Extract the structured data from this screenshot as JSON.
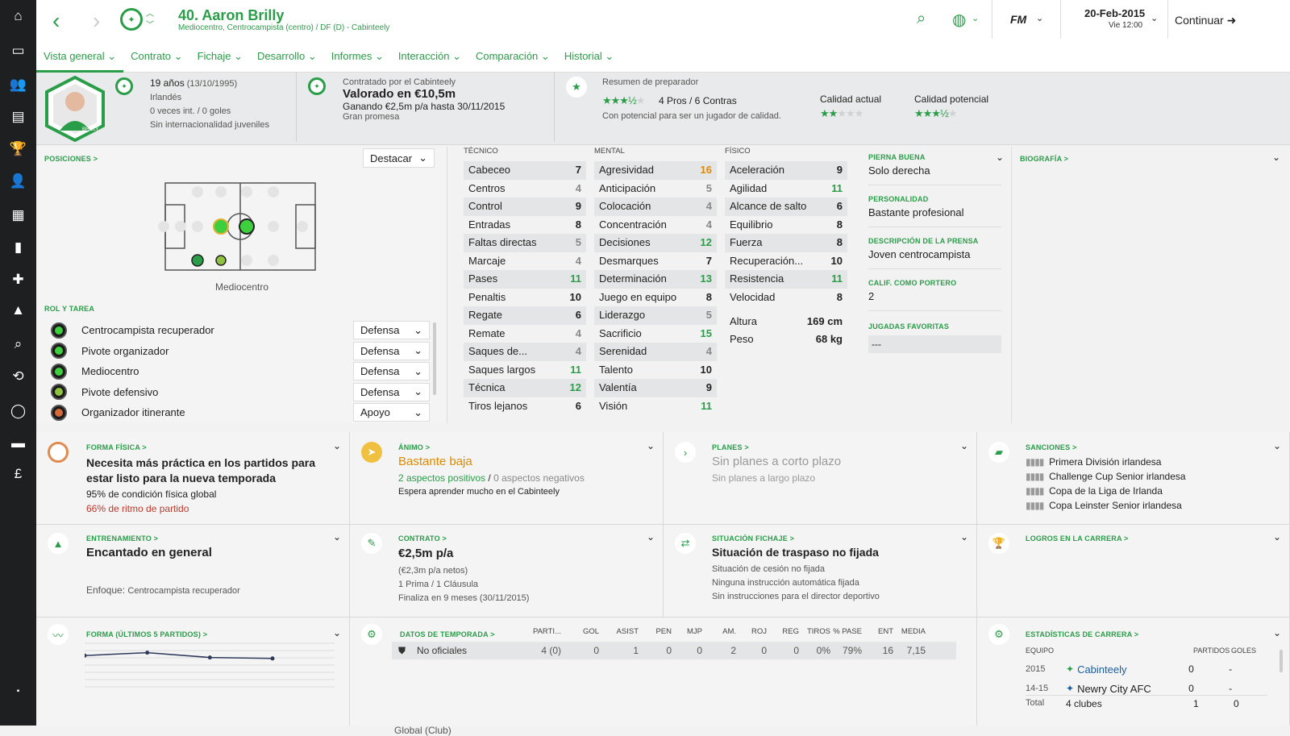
{
  "sidebar": {
    "icons": [
      "home-icon",
      "inbox-icon",
      "squad-icon",
      "calendar-icon",
      "trophy-icon",
      "youth-icon",
      "tactics-icon",
      "scouting-icon",
      "staff-icon",
      "training-icon",
      "search-icon",
      "transfers-icon",
      "club-icon",
      "finances-icon",
      "money-icon",
      "flag-icon"
    ]
  },
  "player": {
    "title": "40. Aaron Brilly",
    "subtitle": "Mediocentro, Centrocampista (centro) / DF (D) - Cabinteely",
    "age": "19 años",
    "dob": "(13/10/1995)",
    "nationality": "Irlandés",
    "caps": "0 veces int. / 0 goles",
    "youth_caps": "Sin internacionalidad juveniles",
    "shirt_name": "BRILLY"
  },
  "tabs": [
    "Vista general",
    "Contrato",
    "Fichaje",
    "Desarrollo",
    "Informes",
    "Interacción",
    "Comparación",
    "Historial"
  ],
  "topbar": {
    "date": "20-Feb-2015",
    "time": "Vie 12:00",
    "continue_label": "Continuar",
    "fm_label": "FM"
  },
  "contract_summary": {
    "line1": "Contratado por el Cabinteely",
    "value": "Valorado en €10,5m",
    "wage": "Ganando €2,5m p/a hasta 30/11/2015",
    "tag": "Gran promesa"
  },
  "coach_report": {
    "label": "Resumen de preparador",
    "pros_cons": "4 Pros / 6 Contras",
    "note": "Con potencial para ser un jugador de calidad.",
    "current_label": "Calidad actual",
    "potential_label": "Calidad potencial",
    "summary_stars": 3.5,
    "current_stars": 2,
    "potential_stars": 3.5
  },
  "positions": {
    "label": "POSICIONES >",
    "highlight_label": "Destacar",
    "position_name": "Mediocentro"
  },
  "roles": {
    "label": "ROL Y TAREA",
    "items": [
      {
        "name": "Centrocampista recuperador",
        "duty": "Defensa",
        "color": "#3ecf3e"
      },
      {
        "name": "Pivote organizador",
        "duty": "Defensa",
        "color": "#3ecf3e"
      },
      {
        "name": "Mediocentro",
        "duty": "Defensa",
        "color": "#3ecf3e"
      },
      {
        "name": "Pivote defensivo",
        "duty": "Defensa",
        "color": "#8fc23e"
      },
      {
        "name": "Organizador itinerante",
        "duty": "Apoyo",
        "color": "#d26a3a"
      }
    ]
  },
  "attributes": {
    "technical_label": "TÉCNICO",
    "mental_label": "MENTAL",
    "physical_label": "FÍSICO",
    "technical": [
      {
        "name": "Cabeceo",
        "value": "7",
        "c": "b"
      },
      {
        "name": "Centros",
        "value": "4",
        "c": "g"
      },
      {
        "name": "Control",
        "value": "9",
        "c": "b"
      },
      {
        "name": "Entradas",
        "value": "8",
        "c": "b"
      },
      {
        "name": "Faltas directas",
        "value": "5",
        "c": "g"
      },
      {
        "name": "Marcaje",
        "value": "4",
        "c": "g"
      },
      {
        "name": "Pases",
        "value": "11",
        "c": "gr"
      },
      {
        "name": "Penaltis",
        "value": "10",
        "c": "b"
      },
      {
        "name": "Regate",
        "value": "6",
        "c": "b"
      },
      {
        "name": "Remate",
        "value": "4",
        "c": "g"
      },
      {
        "name": "Saques de...",
        "value": "4",
        "c": "g"
      },
      {
        "name": "Saques largos",
        "value": "11",
        "c": "gr"
      },
      {
        "name": "Técnica",
        "value": "12",
        "c": "gr"
      },
      {
        "name": "Tiros lejanos",
        "value": "6",
        "c": "b"
      }
    ],
    "mental": [
      {
        "name": "Agresividad",
        "value": "16",
        "c": "o"
      },
      {
        "name": "Anticipación",
        "value": "5",
        "c": "g"
      },
      {
        "name": "Colocación",
        "value": "4",
        "c": "g"
      },
      {
        "name": "Concentración",
        "value": "4",
        "c": "g"
      },
      {
        "name": "Decisiones",
        "value": "12",
        "c": "gr"
      },
      {
        "name": "Desmarques",
        "value": "7",
        "c": "b"
      },
      {
        "name": "Determinación",
        "value": "13",
        "c": "gr"
      },
      {
        "name": "Juego en equipo",
        "value": "8",
        "c": "b"
      },
      {
        "name": "Liderazgo",
        "value": "5",
        "c": "g"
      },
      {
        "name": "Sacrificio",
        "value": "15",
        "c": "gr"
      },
      {
        "name": "Serenidad",
        "value": "4",
        "c": "g"
      },
      {
        "name": "Talento",
        "value": "10",
        "c": "b"
      },
      {
        "name": "Valentía",
        "value": "9",
        "c": "b"
      },
      {
        "name": "Visión",
        "value": "11",
        "c": "gr"
      }
    ],
    "physical": [
      {
        "name": "Aceleración",
        "value": "9",
        "c": "b"
      },
      {
        "name": "Agilidad",
        "value": "11",
        "c": "gr"
      },
      {
        "name": "Alcance de salto",
        "value": "6",
        "c": "b"
      },
      {
        "name": "Equilibrio",
        "value": "8",
        "c": "b"
      },
      {
        "name": "Fuerza",
        "value": "8",
        "c": "b"
      },
      {
        "name": "Recuperación...",
        "value": "10",
        "c": "b"
      },
      {
        "name": "Resistencia",
        "value": "11",
        "c": "gr"
      },
      {
        "name": "Velocidad",
        "value": "8",
        "c": "b"
      }
    ],
    "height_label": "Altura",
    "height": "169 cm",
    "weight_label": "Peso",
    "weight": "68 kg"
  },
  "details": {
    "foot_label": "PIERNA BUENA",
    "foot": "Solo derecha",
    "personality_label": "PERSONALIDAD",
    "personality": "Bastante profesional",
    "press_label": "DESCRIPCIÓN DE LA PRENSA",
    "press": "Joven centrocampista",
    "gk_label": "CALIF. COMO PORTERO",
    "gk": "2",
    "moves_label": "JUGADAS FAVORITAS",
    "moves": "---",
    "bio_label": "BIOGRAFÍA >"
  },
  "fitness": {
    "label": "FORMA FÍSICA >",
    "headline": "Necesita más práctica en los partidos para estar listo para la nueva temporada",
    "condition": "95% de condición física global",
    "match": "66% de ritmo de partido"
  },
  "morale": {
    "label": "ÁNIMO >",
    "value": "Bastante baja",
    "positives": "2 aspectos positivos",
    "sep": "/",
    "negatives": "0 aspectos negativos",
    "note": "Espera aprender mucho en el Cabinteely"
  },
  "plans": {
    "label": "PLANES >",
    "short": "Sin planes a corto plazo",
    "long": "Sin planes a largo plazo"
  },
  "bans": {
    "label": "SANCIONES >",
    "items": [
      "Primera División irlandesa",
      "Challenge Cup Senior irlandesa",
      "Copa de la Liga de Irlanda",
      "Copa Leinster Senior irlandesa"
    ]
  },
  "training": {
    "label": "ENTRENAMIENTO >",
    "happiness": "Encantado en general",
    "focus_label": "Enfoque:",
    "focus": "Centrocampista recuperador"
  },
  "contract": {
    "label": "CONTRATO >",
    "wage": "€2,5m p/a",
    "net": "(€2,3m p/a netos)",
    "bonus": "1 Prima / 1 Cláusula",
    "expiry": "Finaliza en 9 meses",
    "expiry_date": "(30/11/2015)"
  },
  "transfer": {
    "label": "SITUACIÓN FICHAJE >",
    "status": "Situación de traspaso no fijada",
    "loan": "Situación de cesión no fijada",
    "auto": "Ninguna instrucción automática fijada",
    "director": "Sin instrucciones para el director deportivo"
  },
  "achievements": {
    "label": "LOGROS EN LA CARRERA >"
  },
  "form": {
    "label": "FORMA (ÚLTIMOS 5 PARTIDOS) >",
    "points": [
      6.6,
      6.9,
      6.4,
      6.3
    ]
  },
  "season": {
    "label": "DATOS DE TEMPORADA >",
    "headers": [
      "PARTI...",
      "GOL",
      "ASIST",
      "PEN",
      "MJP",
      "AM.",
      "ROJ",
      "REG",
      "TIROS",
      "% PASE",
      "ENT",
      "MEDIA"
    ],
    "row_label": "No oficiales",
    "row": [
      "4 (0)",
      "0",
      "1",
      "0",
      "0",
      "2",
      "0",
      "0",
      "0%",
      "79%",
      "16",
      "7,15"
    ],
    "footer": "Global (Club)"
  },
  "career": {
    "label": "ESTADÍSTICAS DE CARRERA >",
    "col_team": "EQUIPO",
    "col_apps": "PARTIDOS",
    "col_goals": "GOLES",
    "rows": [
      {
        "year": "2015",
        "team": "Cabinteely",
        "apps": "0",
        "goals": "-"
      },
      {
        "year": "14-15",
        "team": "Newry City AFC",
        "apps": "0",
        "goals": "-"
      }
    ],
    "total_label": "Total",
    "total_clubs": "4 clubes",
    "total_apps": "1",
    "total_goals": "0"
  }
}
